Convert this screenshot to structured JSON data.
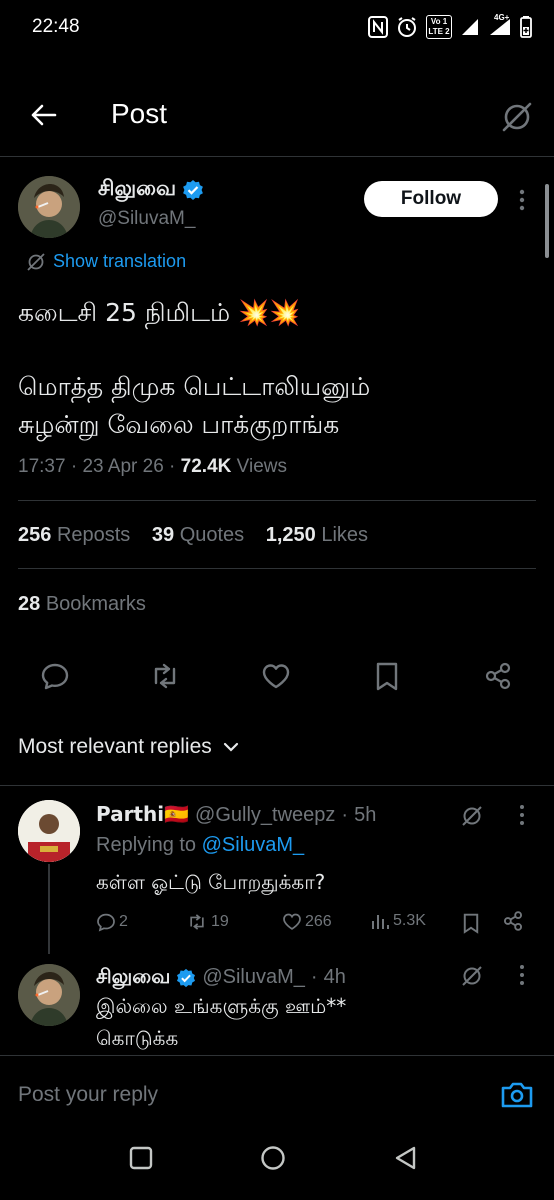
{
  "status": {
    "time": "22:48",
    "net1": "Vo 1",
    "net2": "LTE 2",
    "net3": "4G+"
  },
  "header": {
    "title": "Post"
  },
  "tweet": {
    "author_name": "சிலுவை",
    "author_handle": "@SiluvaM_",
    "follow_label": "Follow",
    "show_translation": "Show translation",
    "text_line1": "கடைசி 25 நிமிடம் 💥💥",
    "text_line2": "மொத்த திமுக பெட்டாலியனும்",
    "text_line3": "சுழன்று வேலை பாக்குறாங்க",
    "time": "17:37",
    "date": "23 Apr 26",
    "views_count": "72.4K",
    "views_label": "Views",
    "reposts_count": "256",
    "reposts_label": "Reposts",
    "quotes_count": "39",
    "quotes_label": "Quotes",
    "likes_count": "1,250",
    "likes_label": "Likes",
    "bookmarks_count": "28",
    "bookmarks_label": "Bookmarks"
  },
  "replies_header": {
    "label": "Most relevant replies"
  },
  "replies": [
    {
      "name": "Parthi🇪🇸",
      "handle": "@Gully_tweepz",
      "time": "5h",
      "replying_prefix": "Replying to",
      "replying_to": "@SiluvaM_",
      "text": "கள்ள ஓட்டு போறதுக்கா?",
      "replies": "2",
      "reposts": "19",
      "likes": "266",
      "views": "5.3K"
    },
    {
      "name": "சிலுவை",
      "handle": "@SiluvaM_",
      "time": "4h",
      "text_line1": "இல்லை உங்களுக்கு ஊம்**",
      "text_line2": "கொடுக்க"
    }
  ],
  "compose": {
    "placeholder": "Post your reply"
  },
  "colors": {
    "accent": "#1d9bf0",
    "background": "#000000",
    "muted": "#71767b",
    "divider": "#2f3336"
  }
}
